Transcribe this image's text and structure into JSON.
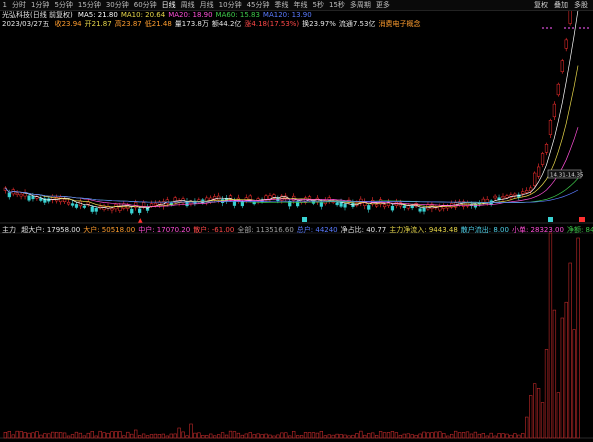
{
  "toolbar": {
    "tabs": [
      "1",
      "分时",
      "1分钟",
      "5分钟",
      "15分钟",
      "30分钟",
      "60分钟",
      "日线",
      "周线",
      "月线",
      "10分钟",
      "45分钟",
      "季线",
      "年线",
      "5秒",
      "15秒",
      "多周期",
      "更多"
    ],
    "active_tab": "日线",
    "right_items": [
      "复权",
      "叠加",
      "多股"
    ]
  },
  "price_header": {
    "stock_name": "光弘科技(日线 前复权)",
    "ma_labels": [
      "MA5: 21.80",
      "MA10: 20.64",
      "MA20: 18.90",
      "MA60: 15.83",
      "MA120: 13.90"
    ]
  },
  "info_line": {
    "date": "2023/03/27五",
    "items": [
      "收23.94",
      "开21.87",
      "高23.87",
      "低21.48",
      "量173.8万",
      "额44.2亿",
      "涨4.18(17.53%)",
      "换23.97%",
      "流通7.53亿",
      "消费电子概念"
    ]
  },
  "price_label": "14.31-14.35",
  "indicator_header": {
    "title": "主力",
    "items": [
      "超大户: 17958.00",
      "大户: 50518.00",
      "中户: 17070.20",
      "散户: -61.00",
      "全部: 113516.60",
      "总户: 44240",
      "净占比: 40.77",
      "主力净流入: 9443.48",
      "散户流出: 8.00",
      "小单: 28323.00",
      "净额: 8443.48"
    ]
  },
  "colors": {
    "up": "#ff3030",
    "down": "#3ad3d3",
    "ma5": "#ffffff",
    "ma10": "#e8d84a",
    "ma20": "#ff4fd8",
    "ma60": "#3ec94b",
    "ma120": "#5a7bff",
    "volume": "#c02a2a"
  }
}
